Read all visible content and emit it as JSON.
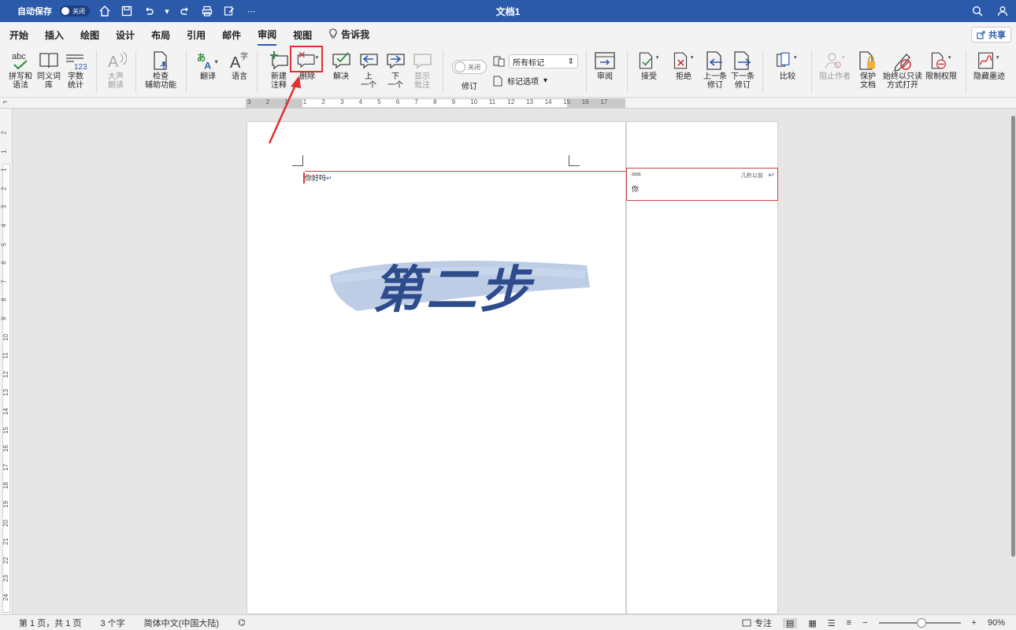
{
  "titlebar": {
    "autosave_label": "自动保存",
    "autosave_state": "关闭",
    "doc_title": "文档1"
  },
  "tabs": [
    "开始",
    "插入",
    "绘图",
    "设计",
    "布局",
    "引用",
    "邮件",
    "审阅",
    "视图"
  ],
  "active_tab": "审阅",
  "tell_me": "告诉我",
  "share_label": "共享",
  "ribbon": {
    "spelling": "拼写和\n语法",
    "thesaurus": "同义词\n库",
    "word_count": "字数\n统计",
    "read_aloud": "大声\n朗读",
    "accessibility": "检查\n辅助功能",
    "translate": "翻译",
    "language": "语言",
    "new_comment": "新建\n注释",
    "delete": "删除",
    "resolve": "解决",
    "prev": "上\n一个",
    "next": "下\n一个",
    "show_comments": "显示\n批注",
    "track_toggle": "关闭",
    "track_label": "修订",
    "markup_select": "所有标记",
    "markup_options": "标记选项",
    "review_pane": "审阅",
    "accept": "接受",
    "reject": "拒绝",
    "prev_change": "上一条\n修订",
    "next_change": "下一条\n修订",
    "compare": "比较",
    "block_authors": "阻止作者",
    "protect": "保护\n文档",
    "always_readonly": "始终以只读\n方式打开",
    "restrict": "限制权限",
    "hide_ink": "隐藏墨迹"
  },
  "ruler_numbers": [
    "3",
    "2",
    "1",
    "1",
    "2",
    "3",
    "4",
    "5",
    "6",
    "7",
    "8",
    "9",
    "10",
    "11",
    "12",
    "13",
    "14",
    "15",
    "16",
    "17"
  ],
  "vruler_numbers": [
    "2",
    "1",
    "1",
    "2",
    "3",
    "4",
    "5",
    "6",
    "7",
    "8",
    "9",
    "10",
    "11",
    "12",
    "13",
    "14",
    "15",
    "16",
    "17",
    "18",
    "19",
    "20",
    "21",
    "22",
    "23",
    "24"
  ],
  "document": {
    "body_text": "你好吗",
    "overlay_text": "第二步"
  },
  "comment": {
    "author": "aaa",
    "time": "几秒以前",
    "text": "你"
  },
  "statusbar": {
    "page": "第 1 页，共 1 页",
    "words": "3 个字",
    "language": "简体中文(中国大陆)",
    "focus": "专注",
    "zoom": "90%"
  },
  "colors": {
    "titlebar": "#2b5aab",
    "highlight": "#e03030",
    "overlay_text": "#2e4b8c",
    "overlay_brush": "#b7c8e3"
  }
}
